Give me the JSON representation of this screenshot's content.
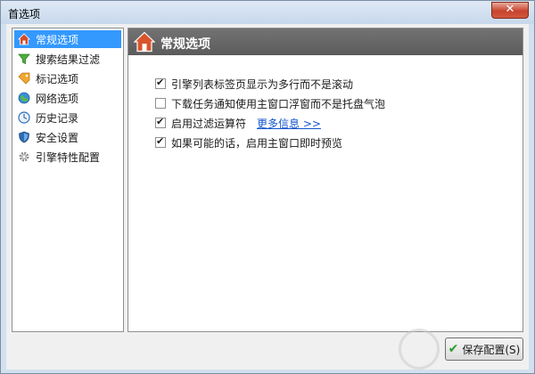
{
  "window": {
    "title": "首选项",
    "close_glyph": "✕"
  },
  "sidebar": {
    "items": [
      {
        "label": "常规选项",
        "icon": "home-icon",
        "selected": true
      },
      {
        "label": "搜索结果过滤",
        "icon": "filter-icon",
        "selected": false
      },
      {
        "label": "标记选项",
        "icon": "tag-icon",
        "selected": false
      },
      {
        "label": "网络选项",
        "icon": "globe-icon",
        "selected": false
      },
      {
        "label": "历史记录",
        "icon": "clock-icon",
        "selected": false
      },
      {
        "label": "安全设置",
        "icon": "shield-icon",
        "selected": false
      },
      {
        "label": "引擎特性配置",
        "icon": "gear-icon",
        "selected": false
      }
    ]
  },
  "panel": {
    "title": "常规选项",
    "options": [
      {
        "label": "引擎列表标签页显示为多行而不是滚动",
        "checked": true
      },
      {
        "label": "下载任务通知使用主窗口浮窗而不是托盘气泡",
        "checked": false
      },
      {
        "label": "启用过滤运算符",
        "checked": true
      },
      {
        "label": "如果可能的话，启用主窗口即时预览",
        "checked": true
      }
    ],
    "more_link": "更多信息 >>"
  },
  "footer": {
    "save_label": "保存配置(S)"
  },
  "colors": {
    "selected": "#3399ff",
    "header": "#666666",
    "link": "#1155cc"
  }
}
